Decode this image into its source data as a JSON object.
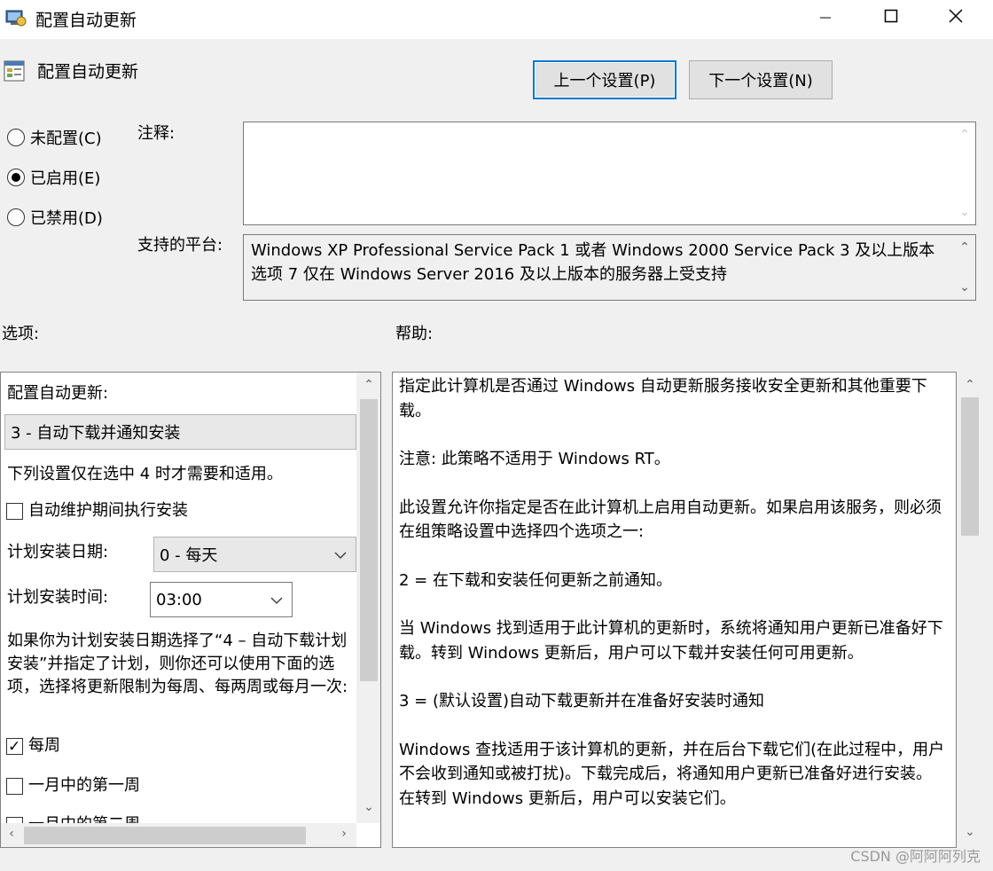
{
  "window": {
    "title": "配置自动更新",
    "icons": {
      "app": "policy-icon",
      "minimize": "minimize-icon",
      "maximize": "maximize-icon",
      "close": "close-icon"
    }
  },
  "header": {
    "title": "配置自动更新",
    "prev_button": "上一个设置(P)",
    "next_button": "下一个设置(N)"
  },
  "state_options": [
    {
      "label": "未配置(C)",
      "selected": false
    },
    {
      "label": "已启用(E)",
      "selected": true
    },
    {
      "label": "已禁用(D)",
      "selected": false
    }
  ],
  "comment": {
    "label": "注释:",
    "value": ""
  },
  "platform": {
    "label": "支持的平台:",
    "value": "Windows XP Professional Service Pack 1 或者 Windows 2000 Service Pack 3 及以上版本",
    "cut_line": "选项 7 仅在 Windows Server 2016 及以上版本的服务器上受支持"
  },
  "options": {
    "label": "选项:",
    "configure_label": "配置自动更新:",
    "configure_value": "3 - 自动下载并通知安装",
    "note": "下列设置仅在选中 4 时才需要和适用。",
    "maintenance_check": {
      "label": "自动维护期间执行安装",
      "checked": false
    },
    "day_label": "计划安装日期:",
    "day_value": "0 - 每天",
    "time_label": "计划安装时间:",
    "time_value": "03:00",
    "para": "如果你为计划安装日期选择了“4 – 自动下载计划安装”并指定了计划，则你还可以使用下面的选项，选择将更新限制为每周、每两周或每月一次:",
    "checks": [
      {
        "label": "每周",
        "checked": true
      },
      {
        "label": "一月中的第一周",
        "checked": false
      },
      {
        "label": "一月中的第二周",
        "checked": false
      }
    ]
  },
  "help": {
    "label": "帮助:",
    "paragraphs": [
      "指定此计算机是否通过 Windows 自动更新服务接收安全更新和其他重要下载。",
      "注意: 此策略不适用于 Windows RT。",
      "此设置允许你指定是否在此计算机上启用自动更新。如果启用该服务，则必须在组策略设置中选择四个选项之一:",
      " 2 = 在下载和安装任何更新之前通知。",
      " 当 Windows 找到适用于此计算机的更新时，系统将通知用户更新已准备好下载。转到 Windows 更新后，用户可以下载并安装任何可用更新。",
      " 3 = (默认设置)自动下载更新并在准备好安装时通知",
      " Windows 查找适用于该计算机的更新，并在后台下载它们(在此过程中，用户不会收到通知或被打扰)。下载完成后，将通知用户更新已准备好进行安装。在转到 Windows 更新后，用户可以安装它们。"
    ]
  },
  "watermark": "CSDN @阿阿阿列克"
}
